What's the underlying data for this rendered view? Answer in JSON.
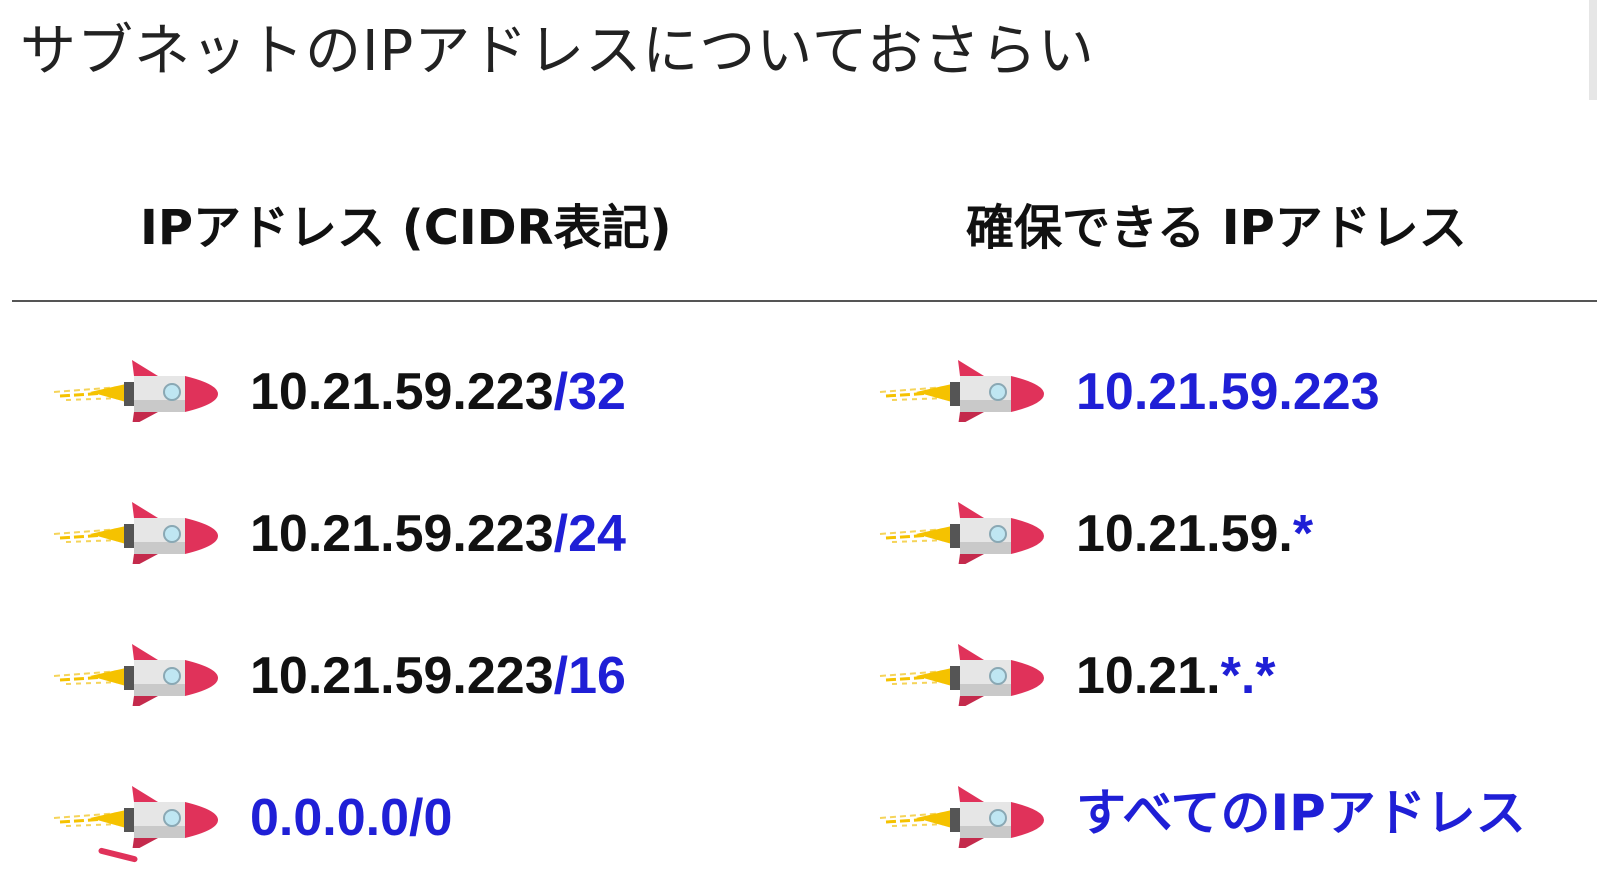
{
  "slide": {
    "title": "サブネットのIPアドレスについておさらい",
    "headers": {
      "left": "IPアドレス (CIDR表記)",
      "right": "確保できる IPアドレス"
    }
  },
  "rows": [
    {
      "cidr_ip": "10.21.59.223",
      "cidr_suffix": "/32",
      "range_black": "",
      "range_blue": "10.21.59.223"
    },
    {
      "cidr_ip": "10.21.59.223",
      "cidr_suffix": "/24",
      "range_black": "10.21.59.",
      "range_blue": "*"
    },
    {
      "cidr_ip": "10.21.59.223",
      "cidr_suffix": "/16",
      "range_black": "10.21.",
      "range_blue": "*.*"
    },
    {
      "cidr_ip": "",
      "cidr_suffix": "0.0.0.0/0",
      "range_black": "",
      "range_blue": "すべてのIPアドレス"
    }
  ],
  "colors": {
    "accent_blue": "#1f1fd6",
    "text": "#111111",
    "rocket_body": "#e8e8e8",
    "rocket_nose": "#e0325a",
    "rocket_flame": "#f5c200"
  },
  "icons": {
    "row_bullet": "rocket-icon"
  }
}
